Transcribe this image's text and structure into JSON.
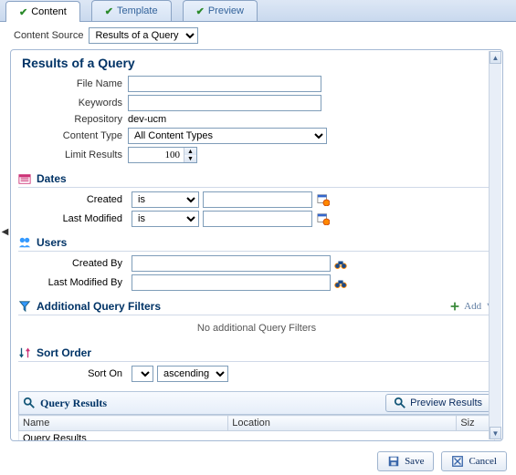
{
  "tabs": {
    "content": "Content",
    "template": "Template",
    "preview": "Preview"
  },
  "contentSource": {
    "label": "Content Source",
    "value": "Results of a Query"
  },
  "title": "Results of a Query",
  "fields": {
    "fileName": {
      "label": "File Name",
      "value": ""
    },
    "keywords": {
      "label": "Keywords",
      "value": ""
    },
    "repository": {
      "label": "Repository",
      "value": "dev-ucm"
    },
    "contentType": {
      "label": "Content Type",
      "value": "All Content Types"
    },
    "limitResults": {
      "label": "Limit Results",
      "value": "100"
    }
  },
  "sections": {
    "dates": {
      "title": "Dates",
      "created": {
        "label": "Created",
        "op": "is",
        "value": ""
      },
      "modified": {
        "label": "Last Modified",
        "op": "is",
        "value": ""
      }
    },
    "users": {
      "title": "Users",
      "createdBy": {
        "label": "Created By",
        "value": ""
      },
      "modifiedBy": {
        "label": "Last Modified By",
        "value": ""
      }
    },
    "filters": {
      "title": "Additional Query Filters",
      "addLabel": "Add",
      "empty": "No additional Query Filters"
    },
    "sort": {
      "title": "Sort Order",
      "label": "Sort On",
      "field": "",
      "dir": "ascending"
    }
  },
  "results": {
    "title": "Query Results",
    "previewBtn": "Preview Results",
    "columns": {
      "name": "Name",
      "location": "Location",
      "size": "Siz"
    },
    "placeholderRow": "Query Results"
  },
  "footer": {
    "save": "Save",
    "cancel": "Cancel"
  }
}
